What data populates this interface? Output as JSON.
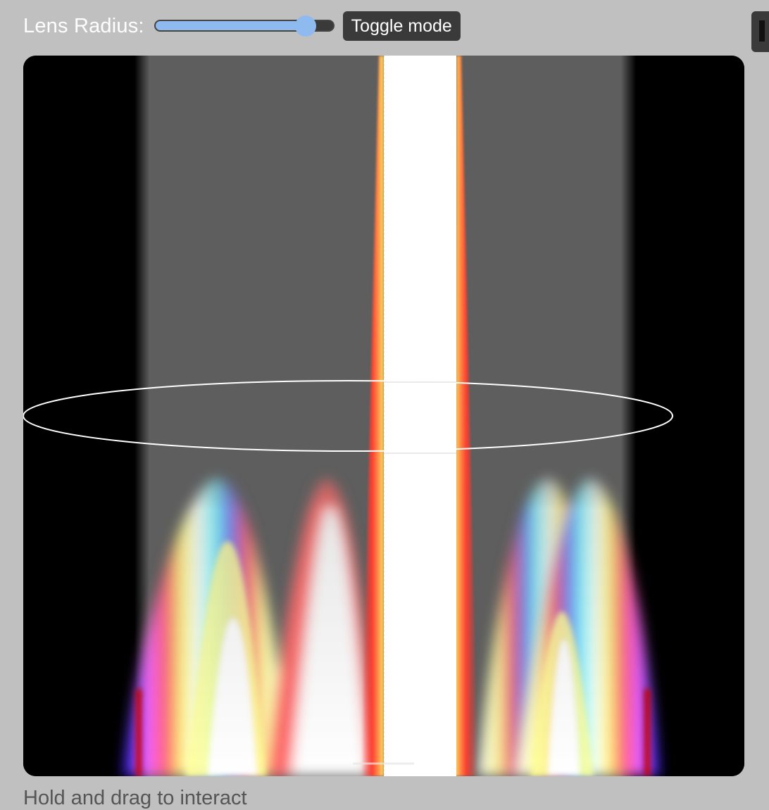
{
  "controls": {
    "lens_radius_label": "Lens Radius:",
    "slider_value_fraction": 0.84,
    "toggle_button_label": "Toggle mode"
  },
  "hint_text": "Hold and drag to interact",
  "colors": {
    "page_background": "#c0c0c0",
    "button_background": "#3a3a3a",
    "slider_accent": "#8fbaf0",
    "canvas_background": "#000000"
  }
}
